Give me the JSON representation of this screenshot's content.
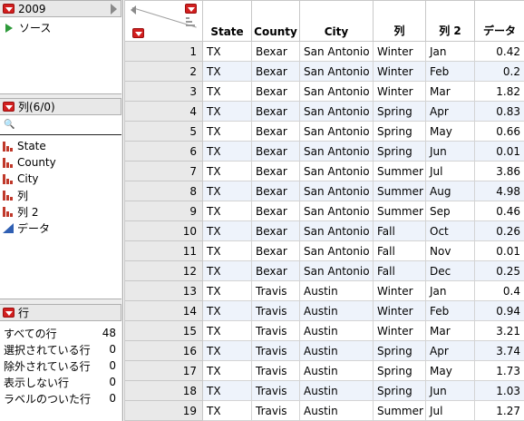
{
  "colors": {
    "accent_red": "#d21f1f",
    "source_green": "#2e9a3a",
    "nominal_red": "#c0392b",
    "continuous_blue": "#2f5fb3",
    "alt_row": "#eef3fb"
  },
  "table_panel": {
    "title": "2009",
    "source_label": "ソース"
  },
  "columns_panel": {
    "title": "列(6/0)",
    "search_icon": "🔍",
    "items": [
      {
        "label": "State",
        "icon": "nominal-bars-icon"
      },
      {
        "label": "County",
        "icon": "nominal-bars-icon"
      },
      {
        "label": "City",
        "icon": "nominal-bars-icon"
      },
      {
        "label": "列",
        "icon": "nominal-bars-icon"
      },
      {
        "label": "列 2",
        "icon": "nominal-bars-icon"
      },
      {
        "label": "データ",
        "icon": "continuous-triangle-icon"
      }
    ]
  },
  "rows_panel": {
    "title": "行",
    "stats": [
      {
        "label": "すべての行",
        "value": "48"
      },
      {
        "label": "選択されている行",
        "value": "0"
      },
      {
        "label": "除外されている行",
        "value": "0"
      },
      {
        "label": "表示しない行",
        "value": "0"
      },
      {
        "label": "ラベルのついた行",
        "value": "0"
      }
    ]
  },
  "grid": {
    "headers": [
      "State",
      "County",
      "City",
      "列",
      "列 2",
      "データ"
    ],
    "rows": [
      [
        "1",
        "TX",
        "Bexar",
        "San Antonio",
        "Winter",
        "Jan",
        "0.42"
      ],
      [
        "2",
        "TX",
        "Bexar",
        "San Antonio",
        "Winter",
        "Feb",
        "0.2"
      ],
      [
        "3",
        "TX",
        "Bexar",
        "San Antonio",
        "Winter",
        "Mar",
        "1.82"
      ],
      [
        "4",
        "TX",
        "Bexar",
        "San Antonio",
        "Spring",
        "Apr",
        "0.83"
      ],
      [
        "5",
        "TX",
        "Bexar",
        "San Antonio",
        "Spring",
        "May",
        "0.66"
      ],
      [
        "6",
        "TX",
        "Bexar",
        "San Antonio",
        "Spring",
        "Jun",
        "0.01"
      ],
      [
        "7",
        "TX",
        "Bexar",
        "San Antonio",
        "Summer",
        "Jul",
        "3.86"
      ],
      [
        "8",
        "TX",
        "Bexar",
        "San Antonio",
        "Summer",
        "Aug",
        "4.98"
      ],
      [
        "9",
        "TX",
        "Bexar",
        "San Antonio",
        "Summer",
        "Sep",
        "0.46"
      ],
      [
        "10",
        "TX",
        "Bexar",
        "San Antonio",
        "Fall",
        "Oct",
        "0.26"
      ],
      [
        "11",
        "TX",
        "Bexar",
        "San Antonio",
        "Fall",
        "Nov",
        "0.01"
      ],
      [
        "12",
        "TX",
        "Bexar",
        "San Antonio",
        "Fall",
        "Dec",
        "0.25"
      ],
      [
        "13",
        "TX",
        "Travis",
        "Austin",
        "Winter",
        "Jan",
        "0.4"
      ],
      [
        "14",
        "TX",
        "Travis",
        "Austin",
        "Winter",
        "Feb",
        "0.94"
      ],
      [
        "15",
        "TX",
        "Travis",
        "Austin",
        "Winter",
        "Mar",
        "3.21"
      ],
      [
        "16",
        "TX",
        "Travis",
        "Austin",
        "Spring",
        "Apr",
        "3.74"
      ],
      [
        "17",
        "TX",
        "Travis",
        "Austin",
        "Spring",
        "May",
        "1.73"
      ],
      [
        "18",
        "TX",
        "Travis",
        "Austin",
        "Spring",
        "Jun",
        "1.03"
      ],
      [
        "19",
        "TX",
        "Travis",
        "Austin",
        "Summer",
        "Jul",
        "1.27"
      ]
    ]
  }
}
